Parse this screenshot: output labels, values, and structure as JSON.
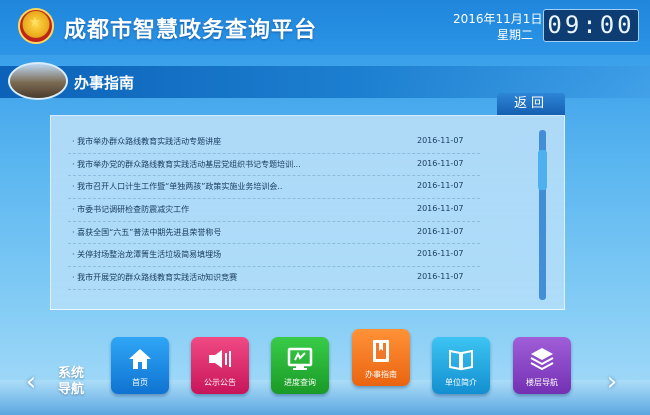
{
  "header": {
    "site_title": "成都市智慧政务查询平台",
    "date": "2016年11月1日",
    "weekday": "星期二",
    "clock": "09:00"
  },
  "section": {
    "title": "办事指南",
    "back_label": "返回"
  },
  "list": [
    {
      "title": "· 我市举办群众路线教育实践活动专题讲座",
      "date": "2016-11-07"
    },
    {
      "title": "· 我市举办党的群众路线教育实践活动基层党组织书记专题培训...",
      "date": "2016-11-07"
    },
    {
      "title": "· 我市召开人口计生工作暨“单独两孩”政策实施业务培训会..",
      "date": "2016-11-07"
    },
    {
      "title": "· 市委书记调研检查防震减灾工作",
      "date": "2016-11-07"
    },
    {
      "title": "· 喜获全国“六五”普法中期先进县荣誉称号",
      "date": "2016-11-07"
    },
    {
      "title": "· 关停封场整治龙潭箐生活垃圾简易填埋场",
      "date": "2016-11-07"
    },
    {
      "title": "· 我市开展党的群众路线教育实践活动知识竞赛",
      "date": "2016-11-07"
    }
  ],
  "nav": {
    "label": "系统导航",
    "tiles": [
      {
        "label": "首页",
        "icon": "home-icon"
      },
      {
        "label": "公示公告",
        "icon": "speaker-icon"
      },
      {
        "label": "进度查询",
        "icon": "monitor-icon"
      },
      {
        "label": "办事指南",
        "icon": "book-icon"
      },
      {
        "label": "单位简介",
        "icon": "open-book-icon"
      },
      {
        "label": "楼层导航",
        "icon": "layers-icon"
      }
    ]
  },
  "colors": {
    "home": "#1a8de6",
    "notice": "#e0306f",
    "progress": "#2bb33a",
    "guide": "#f57a22",
    "intro": "#25aae3",
    "floor": "#8a45c6"
  }
}
